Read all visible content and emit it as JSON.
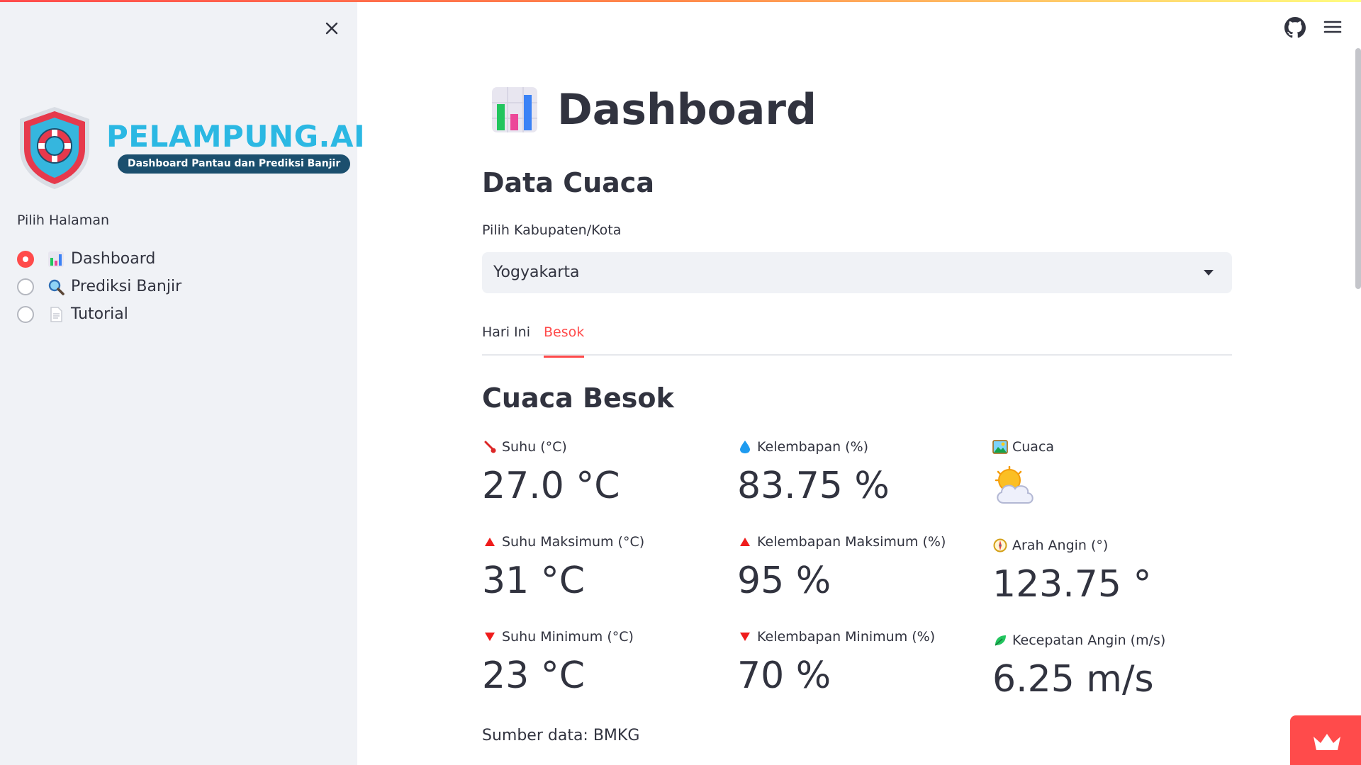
{
  "sidebar": {
    "close_icon": "close-icon",
    "logo": {
      "title": "PELAMPUNG.AI",
      "subtitle": "Dashboard Pantau dan Prediksi Banjir"
    },
    "radio_caption": "Pilih Halaman",
    "items": [
      {
        "label": "Dashboard",
        "icon": "bar-chart-icon",
        "checked": true
      },
      {
        "label": "Prediksi Banjir",
        "icon": "magnifier-icon",
        "checked": false
      },
      {
        "label": "Tutorial",
        "icon": "document-icon",
        "checked": false
      }
    ]
  },
  "header": {
    "github_icon": "github-icon",
    "menu_icon": "hamburger-menu-icon"
  },
  "main": {
    "title": "Dashboard",
    "section_title": "Data Cuaca",
    "select": {
      "label": "Pilih Kabupaten/Kota",
      "value": "Yogyakarta"
    },
    "tabs": [
      {
        "label": "Hari Ini",
        "active": false
      },
      {
        "label": "Besok",
        "active": true
      }
    ],
    "subheader": "Cuaca Besok",
    "metrics": {
      "suhu": {
        "label": "Suhu (°C)",
        "value": "27.0 °C",
        "icon": "thermometer-icon"
      },
      "kelembapan": {
        "label": "Kelembapan (%)",
        "value": "83.75 %",
        "icon": "droplet-icon"
      },
      "cuaca": {
        "label": "Cuaca",
        "icon": "picture-icon",
        "value_icon": "partly-cloudy-icon"
      },
      "suhu_max": {
        "label": "Suhu Maksimum (°C)",
        "value": "31 °C",
        "icon": "triangle-up-icon"
      },
      "kelembapan_max": {
        "label": "Kelembapan Maksimum (%)",
        "value": "95 %",
        "icon": "triangle-up-icon"
      },
      "arah_angin": {
        "label": "Arah Angin (°)",
        "value": "123.75 °",
        "icon": "compass-icon"
      },
      "suhu_min": {
        "label": "Suhu Minimum (°C)",
        "value": "23 °C",
        "icon": "triangle-down-icon"
      },
      "kelembapan_min": {
        "label": "Kelembapan Minimum (%)",
        "value": "70 %",
        "icon": "triangle-down-icon"
      },
      "kecepatan_angin": {
        "label": "Kecepatan Angin (m/s)",
        "value": "6.25 m/s",
        "icon": "leaf-icon"
      }
    },
    "source": "Sumber data: BMKG"
  },
  "deploy_icon": "crown-icon",
  "colors": {
    "accent": "#ff4b4b",
    "sidebar_bg": "#f0f2f6",
    "text": "#31333f",
    "logo_blue": "#2bb8e3",
    "logo_navy": "#1b4f6e"
  }
}
